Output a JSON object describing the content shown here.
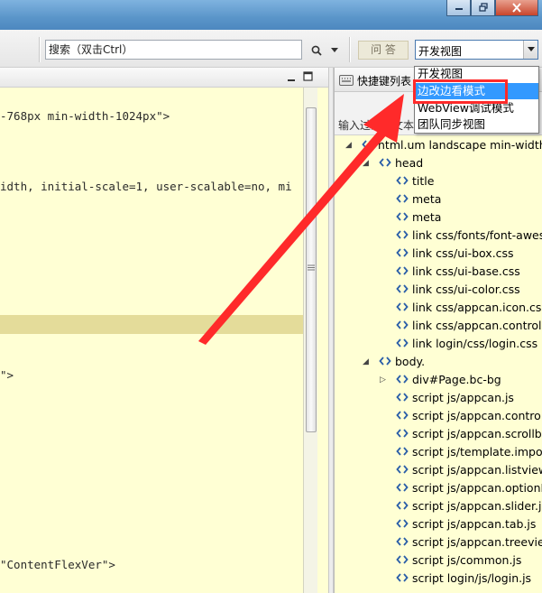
{
  "toolbar": {
    "search_placeholder": "搜索（双击Ctrl）",
    "qa_label": "问 答",
    "view_select_value": "开发视图"
  },
  "view_menu": {
    "items": [
      "开发视图",
      "边改边看模式",
      "WebView调试模式",
      "团队同步视图"
    ],
    "selected_index": 1
  },
  "editor": {
    "lines": [
      "-768px min-width-1024px\">",
      "idth, initial-scale=1, user-scalable=no, mi",
      "\">",
      "\"ContentFlexVer\">"
    ]
  },
  "outline": {
    "header_label": "快捷键列表",
    "filter_label": "输入过滤器文本",
    "nodes": [
      "html.um landscape min-width-",
      "head",
      "title",
      "meta",
      "meta",
      "link css/fonts/font-awes",
      "link css/ui-box.css",
      "link css/ui-base.css",
      "link css/ui-color.css",
      "link css/appcan.icon.css",
      "link css/appcan.control.",
      "link login/css/login.css",
      "body.",
      "div#Page.bc-bg",
      "script js/appcan.js",
      "script js/appcan.control",
      "script js/appcan.scrollb",
      "script js/template.impor",
      "script js/appcan.listview",
      "script js/appcan.optionL",
      "script js/appcan.slider.js",
      "script js/appcan.tab.js",
      "script js/appcan.treeview",
      "script js/common.js",
      "script login/js/login.js"
    ]
  },
  "colors": {
    "editor_bg": "#ffffd4",
    "highlight_line": "#e4dc9a",
    "selection": "#3399ff",
    "annotation_red": "#ff2a2a",
    "keyword_blue": "#2a5ea8"
  }
}
